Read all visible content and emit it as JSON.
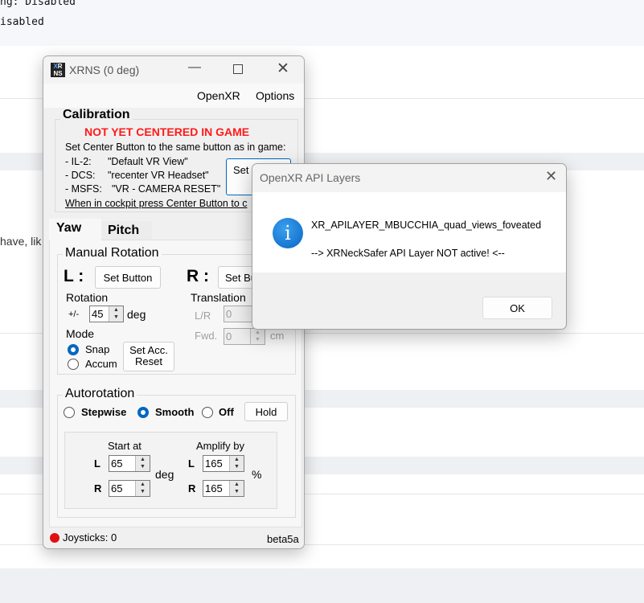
{
  "background": {
    "code_lines": [
      "ng: Disabled",
      "isabled"
    ],
    "partial_text": "have, lik"
  },
  "xrns": {
    "title": "XRNS (0 deg)",
    "logo": "XRNS",
    "menu": [
      "OpenXR",
      "Options"
    ],
    "calibration": {
      "title": "Calibration",
      "warning": "NOT YET CENTERED IN GAME",
      "instruction": "Set Center Button to the same button as in game:",
      "games": [
        {
          "name": "-  IL-2:",
          "action": "\"Default VR View\""
        },
        {
          "name": "-  DCS:",
          "action": "\"recenter VR Headset\""
        },
        {
          "name": "-  MSFS:",
          "action": "\"VR - CAMERA RESET\""
        }
      ],
      "hint": "When in cockpit press Center Button to c",
      "set_button_label": "Set Bu"
    },
    "tabs": [
      "Yaw",
      "Pitch"
    ],
    "active_tab": "Yaw",
    "manual": {
      "title": "Manual Rotation",
      "left_label": "L :",
      "right_label": "R :",
      "set_button": "Set Button",
      "set_button_right": "Set Bu",
      "rotation_label": "Rotation",
      "plusminus": "+/-",
      "rotation_value": "45",
      "deg": "deg",
      "translation_label": "Translation",
      "lr_label": "L/R",
      "lr_value": "0",
      "fwd_label": "Fwd.",
      "fwd_value": "0",
      "cm": "cm",
      "mode_label": "Mode",
      "mode_options": [
        "Snap",
        "Accum"
      ],
      "mode_selected": "Snap",
      "set_acc_reset": [
        "Set Acc.",
        "Reset"
      ]
    },
    "autorotation": {
      "title": "Autorotation",
      "options": [
        "Stepwise",
        "Smooth",
        "Off"
      ],
      "selected": "Smooth",
      "hold": "Hold",
      "start_at": "Start at",
      "amplify_by": "Amplify by",
      "L": "L",
      "R": "R",
      "start_L": "65",
      "start_R": "65",
      "amp_L": "165",
      "amp_R": "165",
      "deg": "deg",
      "percent": "%"
    },
    "status": {
      "joysticks": "Joysticks: 0",
      "version": "beta5a",
      "indicator_color": "#e01010"
    }
  },
  "dialog": {
    "title": "OpenXR API Layers",
    "line1": "XR_APILAYER_MBUCCHIA_quad_views_foveated",
    "line2": "--> XRNeckSafer API Layer NOT active! <--",
    "ok": "OK",
    "icon": "info-icon"
  },
  "colors": {
    "warning": "#ff1a1a",
    "accent": "#0067c0"
  }
}
